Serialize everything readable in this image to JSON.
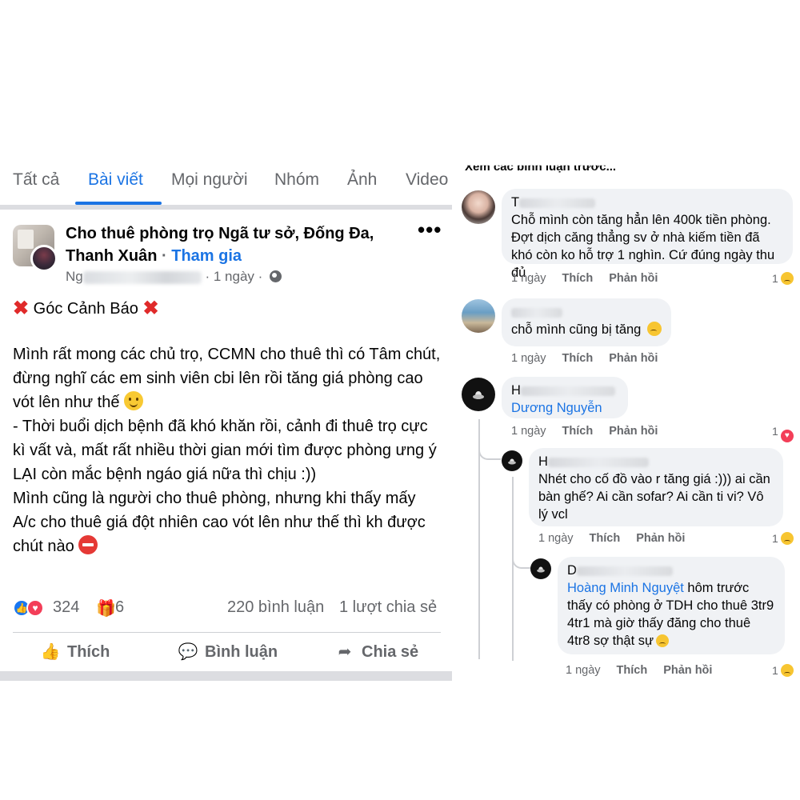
{
  "tabs": [
    "Tất cả",
    "Bài viết",
    "Mọi người",
    "Nhóm",
    "Ảnh",
    "Video"
  ],
  "post": {
    "group_name": "Cho thuê phòng trọ Ngã tư sở, Đống Đa, Thanh Xuân",
    "separator": "·",
    "join": "Tham gia",
    "author_initial": "Ng",
    "time": "· 1 ngày ·",
    "more": "•••",
    "heading": "Góc Cảnh Báo",
    "body_lines": [
      "Mình rất mong các chủ trọ, CCMN cho thuê thì có Tâm chút, đừng nghĩ các em sinh viên cbi lên rồi tăng giá phòng cao vót lên như thế",
      "- Thời buổi dịch bệnh đã khó khăn rồi, cảnh đi thuê trọ cực kì vất và, mất rất nhiều thời gian mới tìm được phòng ưng ý",
      "LẠI còn mắc bệnh ngáo giá nữa thì chịu :))",
      "Mình cũng là người cho thuê phòng, nhưng khi thấy mấy A/c cho thuê giá đột nhiên cao vót lên như thế thì kh được chút nào"
    ],
    "reaction_count": "324",
    "gift_count": "6",
    "comment_count": "220 bình luận",
    "share_count": "1 lượt chia sẻ"
  },
  "actions": {
    "like": "Thích",
    "comment": "Bình luận",
    "share": "Chia sẻ"
  },
  "comments": {
    "prev_link": "Xem các bình luận trước...",
    "items": [
      {
        "initial": "T",
        "text": "Chỗ mình còn tăng hẳn lên 400k tiền phòng. Đợt dịch căng thẳng sv ở nhà kiếm tiền đã khó còn ko hỗ trợ 1 nghìn. Cứ đúng ngày thu đủ",
        "time": "1 ngày",
        "like": "Thích",
        "reply": "Phản hồi",
        "react_count": "1"
      },
      {
        "initial": "",
        "text": "chỗ mình cũng bị tăng",
        "time": "1 ngày",
        "like": "Thích",
        "reply": "Phản hồi",
        "react_count": ""
      },
      {
        "initial": "H",
        "mention": "Dương Nguyễn",
        "text": "",
        "time": "1 ngày",
        "like": "Thích",
        "reply": "Phản hồi",
        "react_count": "1"
      },
      {
        "initial": "H",
        "text": "Nhét cho cố đồ vào r tăng giá :))) ai cần bàn ghế? Ai cần sofar? Ai cần ti vi? Vô lý vcl",
        "time": "1 ngày",
        "like": "Thích",
        "reply": "Phản hồi",
        "react_count": "1"
      },
      {
        "initial": "D",
        "mention": "Hoàng Minh Nguyệt",
        "text": " hôm trước thấy có phòng ở TDH cho thuê 3tr9 4tr1 mà giờ thấy đăng cho thuê 4tr8 sợ thật sự",
        "time": "1 ngày",
        "like": "Thích",
        "reply": "Phản hồi",
        "react_count": "1"
      }
    ]
  },
  "colors": {
    "accent": "#1b74e4",
    "muted": "#65676b",
    "bubble": "#f0f2f5",
    "warning_red": "#e02a2a"
  }
}
